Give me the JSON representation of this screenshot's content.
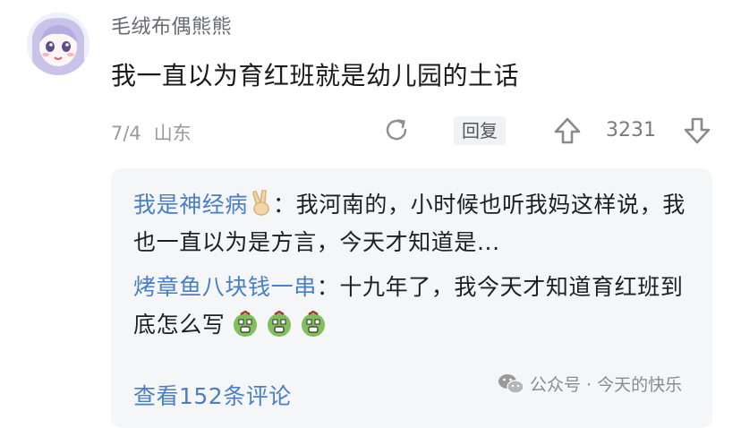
{
  "comment": {
    "username": "毛绒布偶熊熊",
    "text": "我一直以为育红班就是幼儿园的土话",
    "date": "7/4",
    "location": "山东",
    "reply_label": "回复",
    "vote_count": "3231",
    "icons": [
      "avatar",
      "share-icon",
      "thumb-up-icon",
      "thumb-down-icon"
    ]
  },
  "replies": [
    {
      "name": "我是神经病",
      "emoji": "victory-hand-emoji",
      "sep": "：",
      "text": "我河南的，小时候也听我妈这样说，我也一直以为是方言，今天才知道是..."
    },
    {
      "name": "烤章鱼八块钱一串",
      "sep": "：",
      "text": "十九年了，我今天才知道育红班到底怎么写",
      "emoji": "green-stunned-face-emoji",
      "emoji_count": 3
    }
  ],
  "view_more": "查看152条评论",
  "watermark": "公众号 · 今天的快乐",
  "colors": {
    "link_blue": "#4a7ec5",
    "reply_panel_bg": "#f5f6f8",
    "meta_gray": "#9a9a9a"
  }
}
